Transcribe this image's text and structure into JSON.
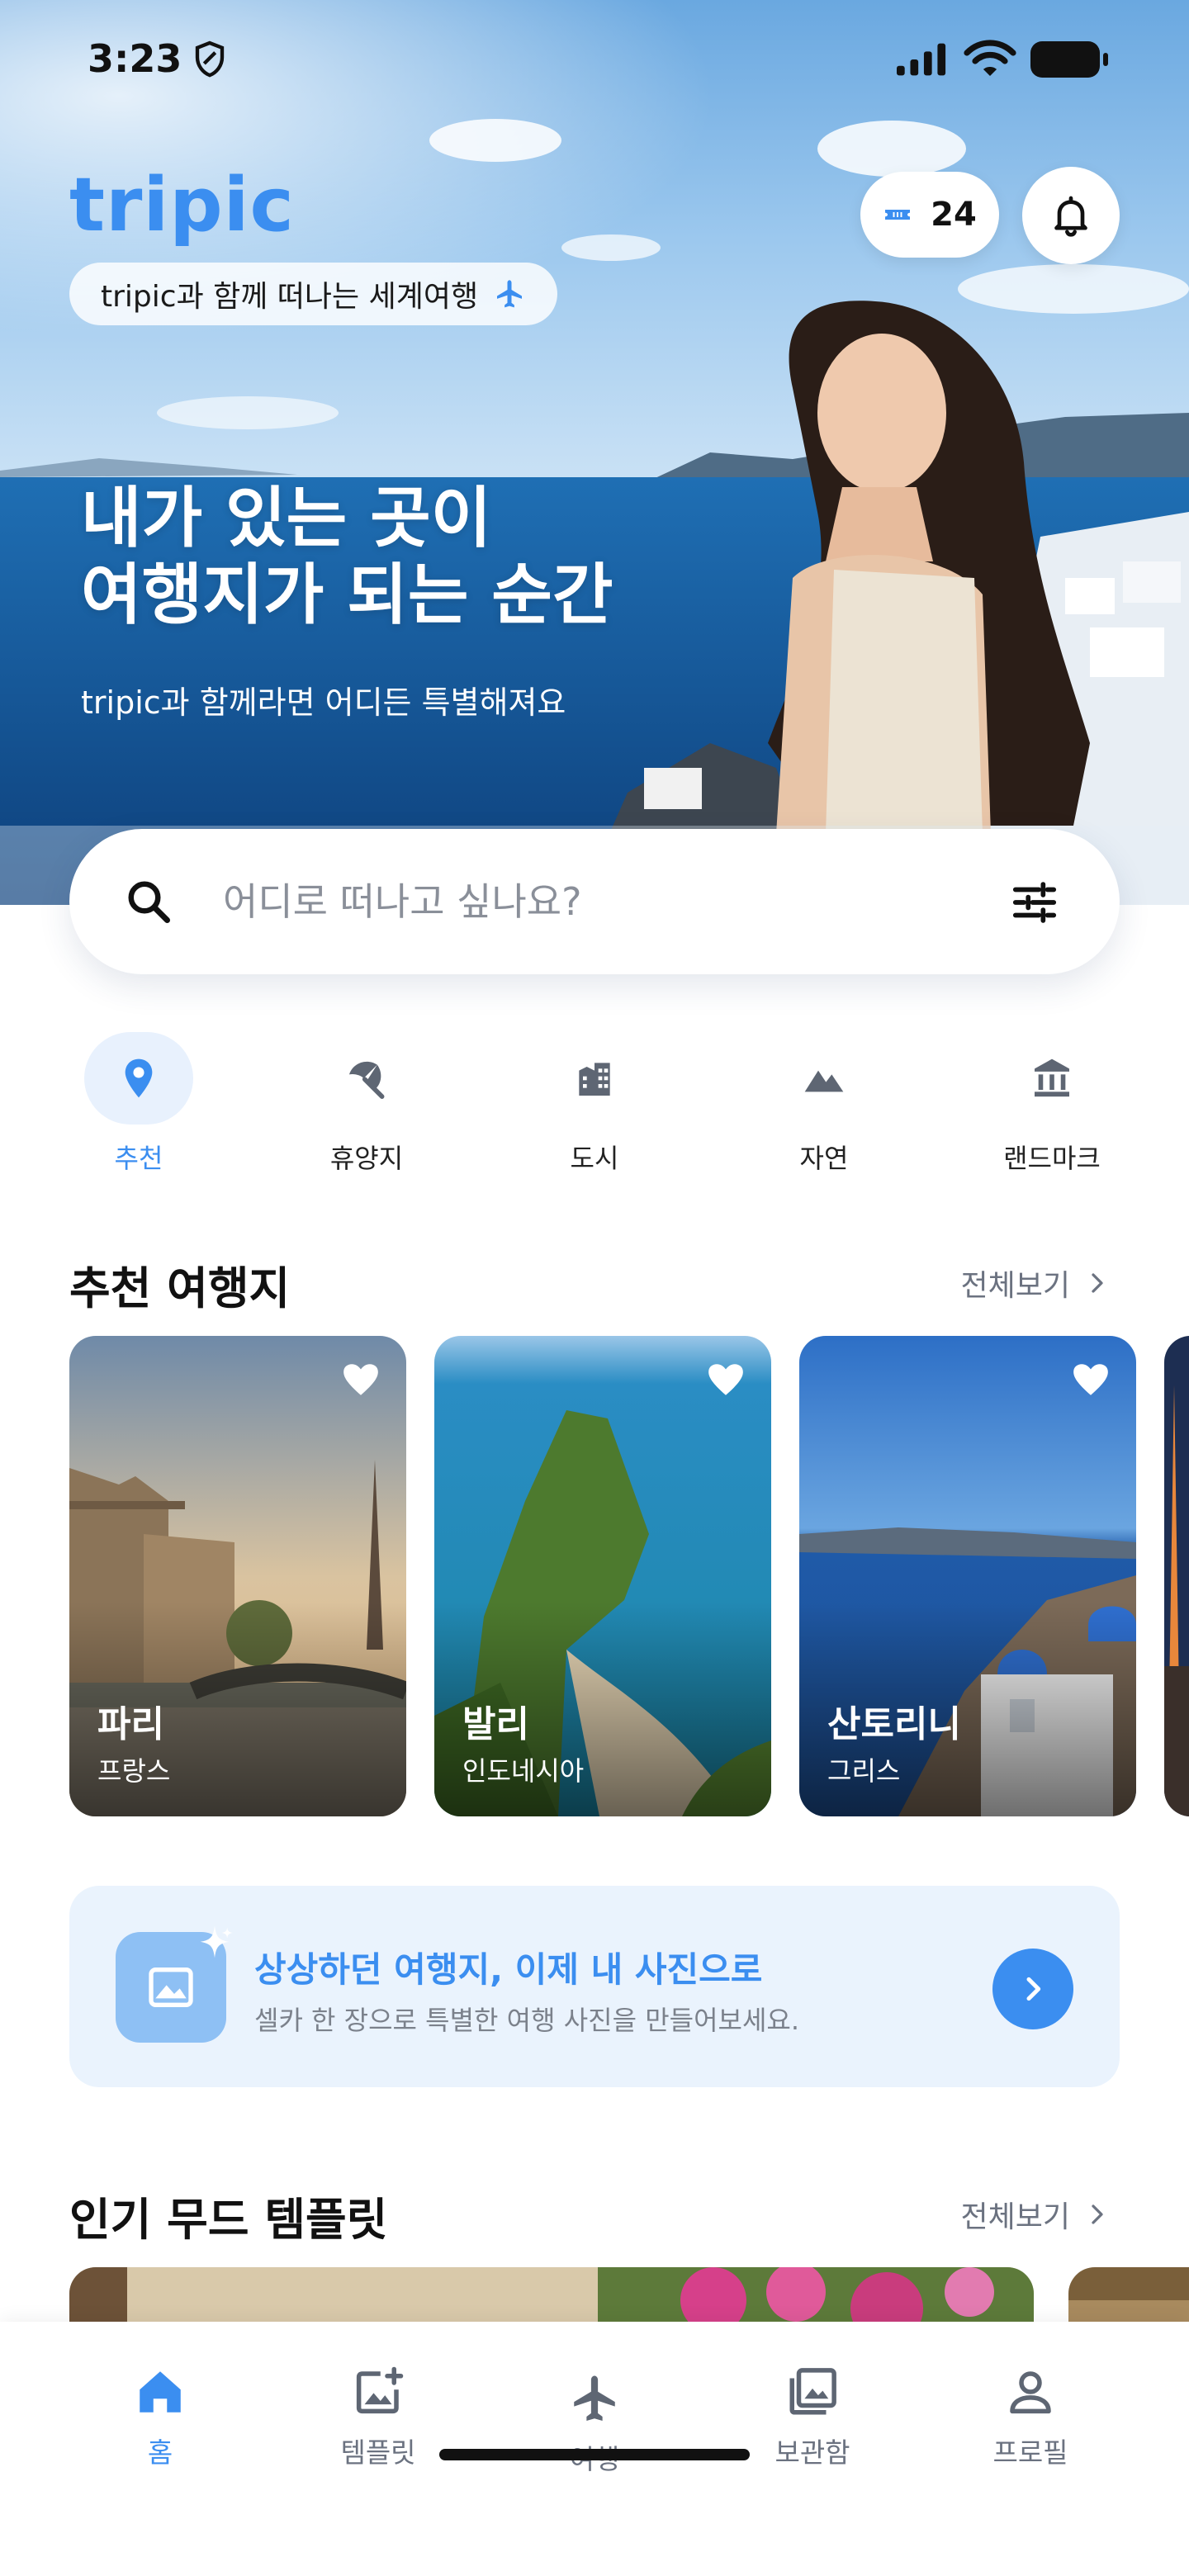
{
  "status_bar": {
    "time": "3:23"
  },
  "app": {
    "brand": "tripic",
    "tagline": "tripic과 함께 떠나는 세계여행",
    "ticket_count": "24"
  },
  "hero": {
    "title_line1": "내가 있는 곳이",
    "title_line2": "여행지가 되는 순간",
    "subtitle": "tripic과 함께라면 어디든 특별해져요"
  },
  "search": {
    "placeholder": "어디로 떠나고 싶나요?"
  },
  "categories": [
    {
      "label": "추천",
      "icon": "location-pin-icon",
      "active": true
    },
    {
      "label": "휴양지",
      "icon": "beach-umbrella-icon",
      "active": false
    },
    {
      "label": "도시",
      "icon": "city-icon",
      "active": false
    },
    {
      "label": "자연",
      "icon": "mountain-icon",
      "active": false
    },
    {
      "label": "랜드마크",
      "icon": "landmark-icon",
      "active": false
    }
  ],
  "recommended": {
    "title": "추천 여행지",
    "more": "전체보기",
    "items": [
      {
        "city": "파리",
        "country": "프랑스"
      },
      {
        "city": "발리",
        "country": "인도네시아"
      },
      {
        "city": "산토리니",
        "country": "그리스"
      }
    ]
  },
  "promo": {
    "title": "상상하던 여행지, 이제 내 사진으로",
    "subtitle": "셀카 한 장으로 특별한 여행 사진을 만들어보세요."
  },
  "templates": {
    "title": "인기 무드 템플릿",
    "more": "전체보기"
  },
  "tabbar": [
    {
      "label": "홈",
      "icon": "home-icon",
      "active": true
    },
    {
      "label": "템플릿",
      "icon": "template-add-icon",
      "active": false
    },
    {
      "label": "여행",
      "icon": "airplane-icon",
      "active": false
    },
    {
      "label": "보관함",
      "icon": "gallery-icon",
      "active": false
    },
    {
      "label": "프로필",
      "icon": "profile-icon",
      "active": false
    }
  ],
  "colors": {
    "accent": "#3b8ef0",
    "accent_light": "#e8f1fd",
    "promo_bg": "#eaf3fd"
  }
}
